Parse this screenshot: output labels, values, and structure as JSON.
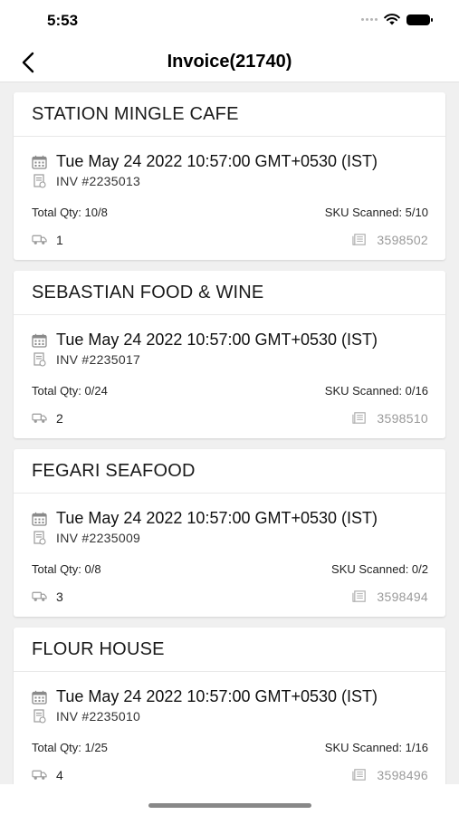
{
  "status_bar": {
    "time": "5:53"
  },
  "nav": {
    "title": "Invoice(21740)",
    "back_icon": "chevron-left-icon"
  },
  "icons": {
    "date": "calendar-icon",
    "invoice": "receipt-icon",
    "route": "truck-icon",
    "code": "document-icon"
  },
  "invoices": [
    {
      "store": "STATION MINGLE CAFE",
      "date": "Tue May 24 2022 10:57:00 GMT+0530 (IST)",
      "invoice_no": "INV #2235013",
      "total_qty": "Total Qty: 10/8",
      "sku_scanned": "SKU Scanned: 5/10",
      "route": "1",
      "code": "3598502"
    },
    {
      "store": "SEBASTIAN FOOD & WINE",
      "date": "Tue May 24 2022 10:57:00 GMT+0530 (IST)",
      "invoice_no": "INV #2235017",
      "total_qty": "Total Qty: 0/24",
      "sku_scanned": "SKU Scanned: 0/16",
      "route": "2",
      "code": "3598510"
    },
    {
      "store": "FEGARI SEAFOOD",
      "date": "Tue May 24 2022 10:57:00 GMT+0530 (IST)",
      "invoice_no": "INV #2235009",
      "total_qty": "Total Qty: 0/8",
      "sku_scanned": "SKU Scanned: 0/2",
      "route": "3",
      "code": "3598494"
    },
    {
      "store": "FLOUR HOUSE",
      "date": "Tue May 24 2022 10:57:00 GMT+0530 (IST)",
      "invoice_no": "INV #2235010",
      "total_qty": "Total Qty: 1/25",
      "sku_scanned": "SKU Scanned: 1/16",
      "route": "4",
      "code": "3598496"
    }
  ],
  "colors": {
    "background": "#f0f0f0",
    "card": "#ffffff",
    "muted_text": "#9a9a9a"
  }
}
